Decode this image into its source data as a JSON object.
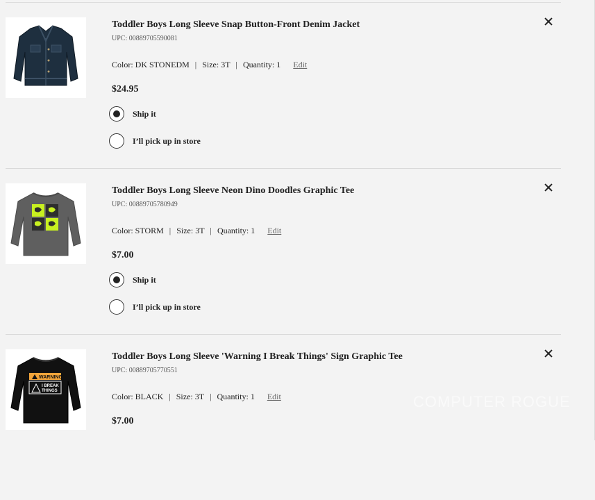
{
  "cart": {
    "items": [
      {
        "title": "Toddler Boys Long Sleeve Snap Button-Front Denim Jacket",
        "upc": "UPC: 00889705590081",
        "color": "Color: DK STONEDM",
        "size": "Size: 3T",
        "quantity": "Quantity: 1",
        "edit_label": "Edit",
        "price": "$24.95",
        "ship_label": "Ship it",
        "pickup_label": "I’ll pick up in store",
        "selected_option": "ship",
        "image_icon": "denim-jacket-image"
      },
      {
        "title": "Toddler Boys Long Sleeve Neon Dino Doodles Graphic Tee",
        "upc": "UPC: 00889705780949",
        "color": "Color: STORM",
        "size": "Size: 3T",
        "quantity": "Quantity: 1",
        "edit_label": "Edit",
        "price": "$7.00",
        "ship_label": "Ship it",
        "pickup_label": "I’ll pick up in store",
        "selected_option": "ship",
        "image_icon": "gray-dino-tee-image"
      },
      {
        "title": "Toddler Boys Long Sleeve 'Warning I Break Things' Sign Graphic Tee",
        "upc": "UPC: 00889705770551",
        "color": "Color: BLACK",
        "size": "Size: 3T",
        "quantity": "Quantity: 1",
        "edit_label": "Edit",
        "price": "$7.00",
        "image_icon": "black-warning-tee-image",
        "image_text": {
          "warning": "WARNING",
          "line1": "I BREAK",
          "line2": "THINGS"
        }
      }
    ],
    "separator": "|",
    "remove_icon": "close-icon"
  },
  "watermark": "COMPUTER ROGUE",
  "colors": {
    "background": "#f3f3f3",
    "text": "#222222",
    "denim": "#1e2f3f",
    "storm": "#5f5f5f",
    "neon": "#c8f020",
    "warning_orange": "#f2a43a"
  }
}
